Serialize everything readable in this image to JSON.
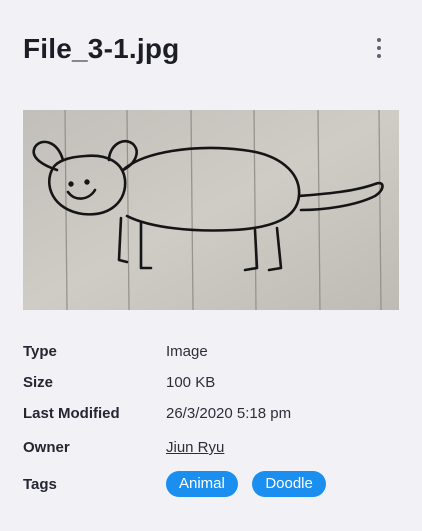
{
  "header": {
    "title": "File_3-1.jpg",
    "more_icon": "vertical-ellipsis-icon"
  },
  "preview": {
    "description_icon": "image-preview",
    "paper_color": "#c9c6c0",
    "ink_color": "#1a1a1a"
  },
  "details": {
    "type_label": "Type",
    "type_value": "Image",
    "size_label": "Size",
    "size_value": "100 KB",
    "modified_label": "Last Modified",
    "modified_value": "26/3/2020 5:18 pm",
    "owner_label": "Owner",
    "owner_value": "Jiun Ryu",
    "tags_label": "Tags",
    "tags": [
      "Animal",
      "Doodle"
    ]
  },
  "colors": {
    "background": "#f2f2f6",
    "tag_background": "#1a8ff0",
    "tag_text": "#ffffff"
  }
}
